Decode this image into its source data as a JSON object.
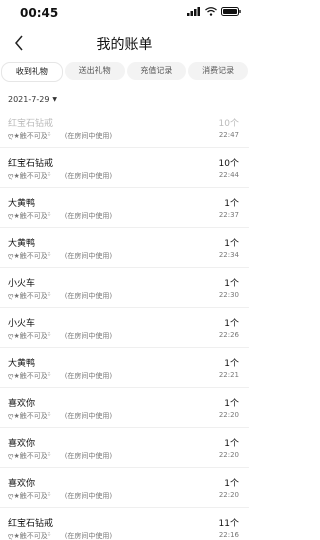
{
  "status_bar": {
    "time": "00:45"
  },
  "header": {
    "title": "我的账单"
  },
  "tabs": [
    {
      "label": "收到礼物",
      "active": true
    },
    {
      "label": "送出礼物",
      "active": false
    },
    {
      "label": "充值记录",
      "active": false
    },
    {
      "label": "消费记录",
      "active": false
    }
  ],
  "date_label": "2021-7-29",
  "records": [
    {
      "gift": "红宝石钻戒",
      "qty": "10个",
      "sender": "ღ★触不可及ᵕ̈",
      "place": "(在房间中使用)",
      "time": "22:47",
      "faded": true
    },
    {
      "gift": "红宝石钻戒",
      "qty": "10个",
      "sender": "ღ★触不可及ᵕ̈",
      "place": "(在房间中使用)",
      "time": "22:44"
    },
    {
      "gift": "大黄鸭",
      "qty": "1个",
      "sender": "ღ★触不可及ᵕ̈",
      "place": "(在房间中使用)",
      "time": "22:37"
    },
    {
      "gift": "大黄鸭",
      "qty": "1个",
      "sender": "ღ★触不可及ᵕ̈",
      "place": "(在房间中使用)",
      "time": "22:34"
    },
    {
      "gift": "小火车",
      "qty": "1个",
      "sender": "ღ★触不可及ᵕ̈",
      "place": "(在房间中使用)",
      "time": "22:30"
    },
    {
      "gift": "小火车",
      "qty": "1个",
      "sender": "ღ★触不可及ᵕ̈",
      "place": "(在房间中使用)",
      "time": "22:26"
    },
    {
      "gift": "大黄鸭",
      "qty": "1个",
      "sender": "ღ★触不可及ᵕ̈",
      "place": "(在房间中使用)",
      "time": "22:21"
    },
    {
      "gift": "喜欢你",
      "qty": "1个",
      "sender": "ღ★触不可及ᵕ̈",
      "place": "(在房间中使用)",
      "time": "22:20"
    },
    {
      "gift": "喜欢你",
      "qty": "1个",
      "sender": "ღ★触不可及ᵕ̈",
      "place": "(在房间中使用)",
      "time": "22:20"
    },
    {
      "gift": "喜欢你",
      "qty": "1个",
      "sender": "ღ★触不可及ᵕ̈",
      "place": "(在房间中使用)",
      "time": "22:20"
    },
    {
      "gift": "红宝石钻戒",
      "qty": "11个",
      "sender": "ღ★触不可及ᵕ̈",
      "place": "(在房间中使用)",
      "time": "22:16"
    }
  ]
}
